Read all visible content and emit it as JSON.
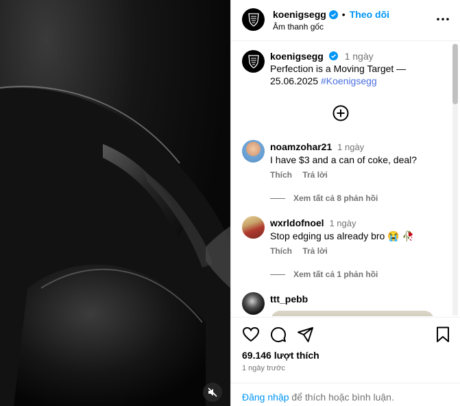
{
  "post": {
    "username": "koenigsegg",
    "follow_label": "Theo dõi",
    "separator": "•",
    "audio_label": "Âm thanh gốc"
  },
  "caption": {
    "username": "koenigsegg",
    "time": "1 ngày",
    "text": "Perfection is a Moving Target — 25.06.2025",
    "hashtag": "#Koenigsegg"
  },
  "comments": [
    {
      "username": "noamzohar21",
      "time": "1 ngày",
      "text": "I have $3 and a can of coke, deal?",
      "like_label": "Thích",
      "reply_label": "Trả lời",
      "view_replies": "Xem tất cả 8 phản hồi"
    },
    {
      "username": "wxrldofnoel",
      "time": "1 ngày",
      "text": "Stop edging us already bro 😭 🥀",
      "like_label": "Thích",
      "reply_label": "Trả lời",
      "view_replies": "Xem tất cả 1 phản hồi"
    },
    {
      "username": "ttt_pebb"
    }
  ],
  "footer": {
    "likes": "69.146 lượt thích",
    "ago": "1 ngày trước",
    "login_link": "Đăng nhập",
    "login_rest": " để thích hoặc bình luận."
  },
  "icons": [
    "koenigsegg-logo-icon",
    "verified-icon",
    "more-icon",
    "add-comment-icon",
    "heart-icon",
    "comment-icon",
    "share-icon",
    "bookmark-icon",
    "mute-icon"
  ],
  "colors": {
    "accent": "#0095f6",
    "hashtag": "#4a6ee0",
    "muted": "#737373"
  }
}
